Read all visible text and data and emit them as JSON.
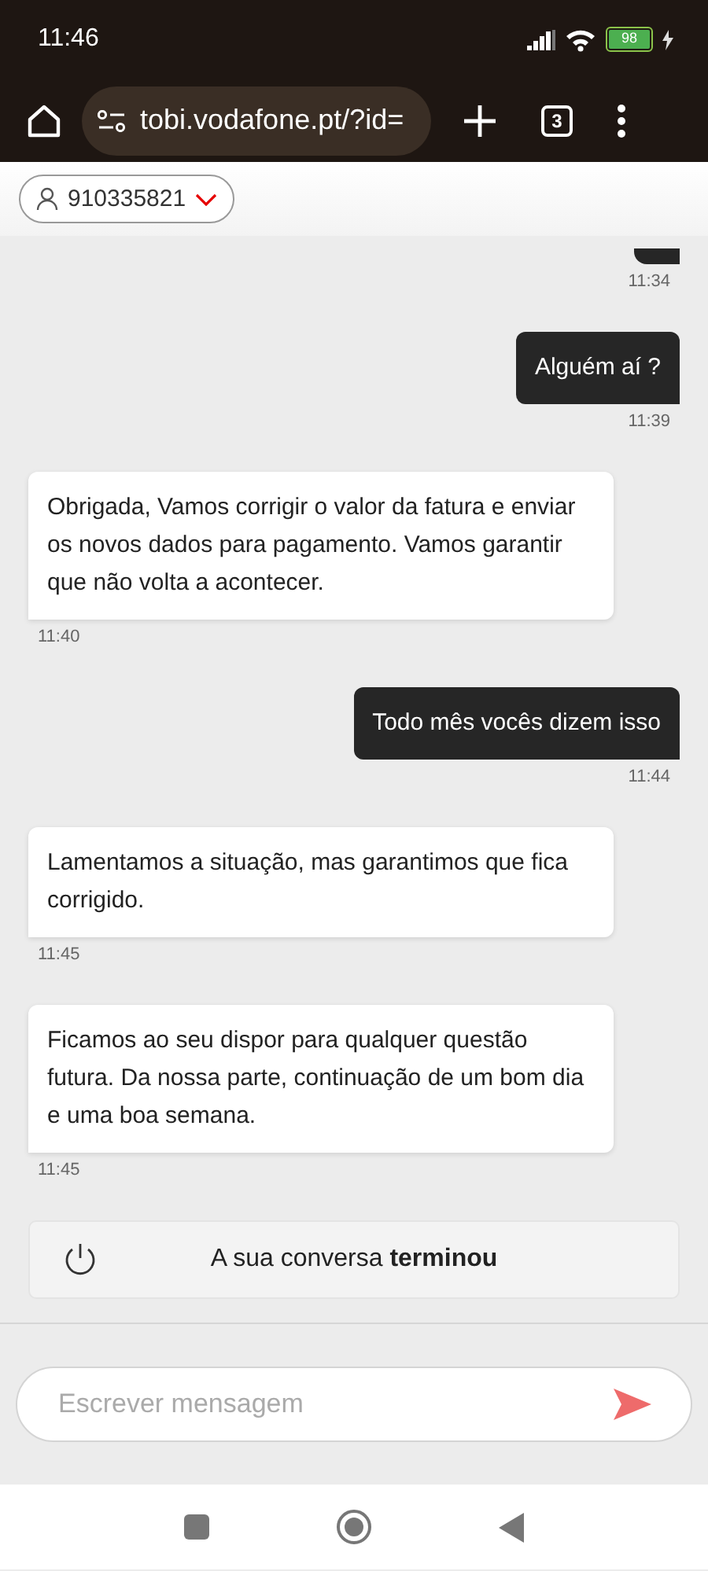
{
  "status_bar": {
    "time": "11:46",
    "battery": "98"
  },
  "browser": {
    "url": "tobi.vodafone.pt/?id=",
    "tab_count": "3"
  },
  "header": {
    "account": "910335821"
  },
  "messages": [
    {
      "kind": "user",
      "time": "11:34"
    },
    {
      "kind": "user",
      "text": "Alguém aí ?",
      "time": "11:39"
    },
    {
      "kind": "agent",
      "text": "Obrigada, Vamos corrigir o valor da fatura e enviar os novos dados para pagamento. Vamos garantir que não volta a acontecer.",
      "time": "11:40"
    },
    {
      "kind": "user",
      "text": "Todo mês vocês dizem isso",
      "time": "11:44"
    },
    {
      "kind": "agent",
      "text": "Lamentamos a situação, mas garantimos que fica corrigido.",
      "time": "11:45"
    },
    {
      "kind": "agent",
      "text": "Ficamos ao seu dispor para qualquer questão futura. Da nossa parte, continuação de um bom dia e uma boa semana.",
      "time": "11:45"
    }
  ],
  "ended_notice": "A sua conversa **terminou**",
  "composer": {
    "placeholder": "Escrever mensagem"
  }
}
